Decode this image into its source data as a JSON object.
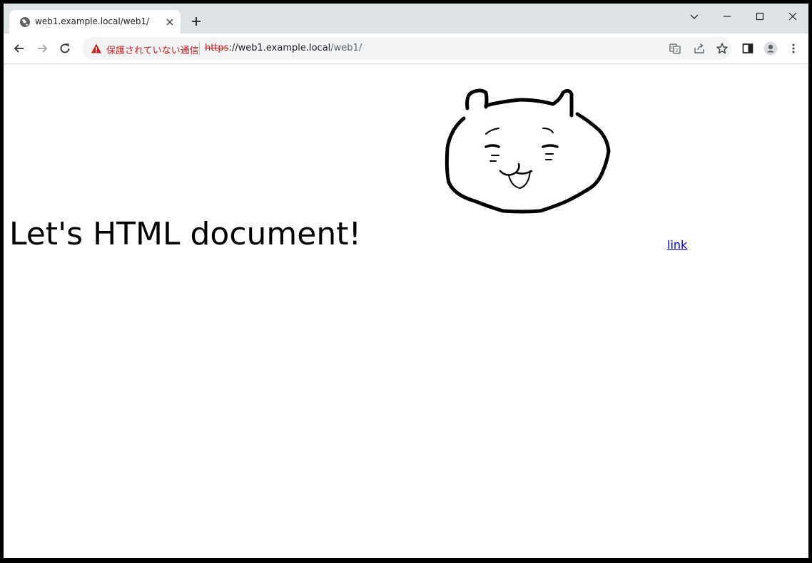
{
  "tab": {
    "title": "web1.example.local/web1/",
    "favicon": "globe-icon"
  },
  "omnibox": {
    "security_warning": "保護されていない通信",
    "url_scheme": "https",
    "url_rest_host": "://web1.example.local",
    "url_path": "/web1/"
  },
  "page": {
    "heading": "Let's HTML document!",
    "link_text": "link",
    "image_name": "cat-drawing"
  },
  "colors": {
    "tabstrip": "#dee3e6",
    "warning": "#c5221f",
    "link": "#0000ee"
  }
}
